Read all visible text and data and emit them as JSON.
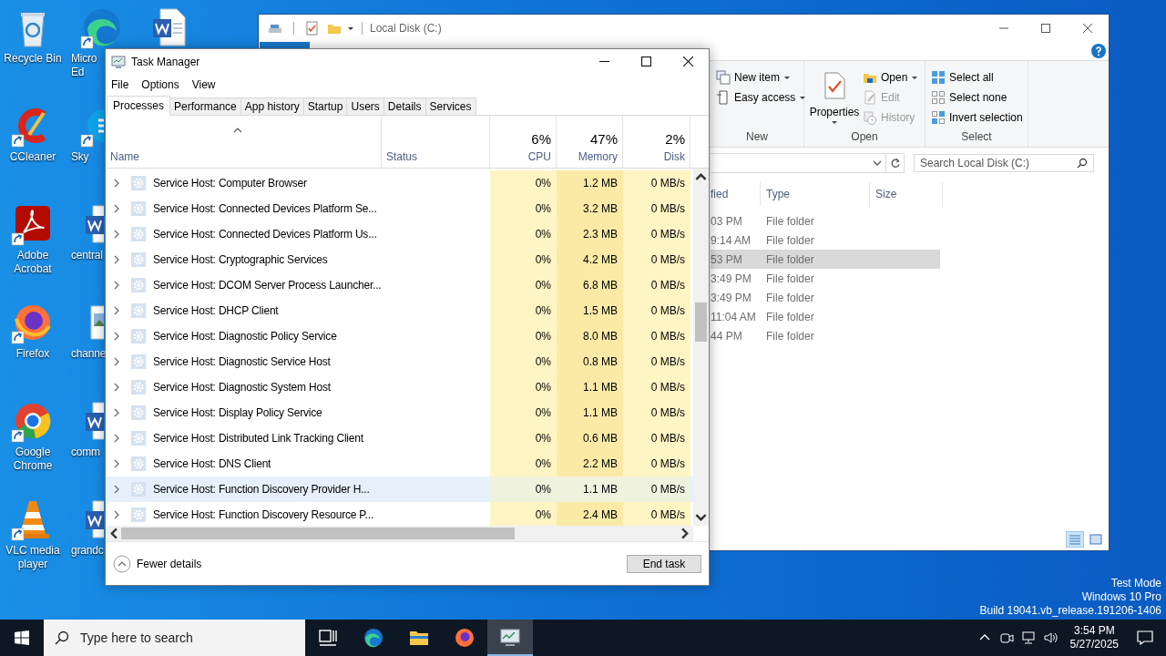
{
  "desktop": {
    "columns": [
      [
        {
          "kind": "recycle",
          "label": "Recycle Bin",
          "shortcut": false
        },
        {
          "kind": "ccleaner",
          "label": "CCleaner",
          "shortcut": true
        },
        {
          "kind": "acrobat",
          "label": "Adobe Acrobat",
          "shortcut": true
        },
        {
          "kind": "firefox",
          "label": "Firefox",
          "shortcut": true
        },
        {
          "kind": "chrome",
          "label": "Google Chrome",
          "shortcut": true
        },
        {
          "kind": "vlc",
          "label": "VLC media player",
          "shortcut": true
        }
      ],
      [
        {
          "kind": "edge",
          "label": "Micro Ed",
          "shortcut": true
        },
        {
          "kind": "skype",
          "label": "Sky",
          "shortcut": true
        },
        {
          "kind": "word",
          "label": "central",
          "shortcut": false
        },
        {
          "kind": "image",
          "label": "channe",
          "shortcut": false
        },
        {
          "kind": "word",
          "label": "comm",
          "shortcut": false
        },
        {
          "kind": "word",
          "label": "grandc",
          "shortcut": false
        }
      ],
      [
        {
          "kind": "word",
          "shortcut": false
        }
      ]
    ],
    "os_notice": [
      "Test Mode",
      "Windows 10 Pro",
      "Build 19041.vb_release.191206-1406"
    ]
  },
  "explorer": {
    "title": "Local Disk (C:)",
    "ribbon_groups": [
      {
        "label": "New",
        "items": [
          {
            "kind": "new-item",
            "label": "New item",
            "dropdown": true,
            "disabled": false
          },
          {
            "kind": "easy-access",
            "label": "Easy access",
            "dropdown": true,
            "disabled": false
          }
        ]
      },
      {
        "label": "Open",
        "items": [
          {
            "kind": "properties",
            "label": "Properties",
            "dropdown": true,
            "disabled": false
          },
          {
            "kind": "open",
            "label": "Open",
            "dropdown": true,
            "disabled": false
          },
          {
            "kind": "edit",
            "label": "Edit",
            "dropdown": false,
            "disabled": true
          },
          {
            "kind": "history",
            "label": "History",
            "dropdown": false,
            "disabled": true
          }
        ]
      },
      {
        "label": "Select",
        "items": [
          {
            "kind": "select-all",
            "label": "Select all",
            "dropdown": false,
            "disabled": false
          },
          {
            "kind": "select-none",
            "label": "Select none",
            "dropdown": false,
            "disabled": false
          },
          {
            "kind": "invert",
            "label": "Invert selection",
            "dropdown": false,
            "disabled": false
          }
        ]
      }
    ],
    "search": {
      "placeholder": "Search Local Disk (C:)"
    },
    "columns": [
      "fied",
      "Type",
      "Size"
    ],
    "rows": [
      {
        "modified": "03 PM",
        "type": "File folder",
        "selected": false
      },
      {
        "modified": "9:14 AM",
        "type": "File folder",
        "selected": false
      },
      {
        "modified": "53 PM",
        "type": "File folder",
        "selected": true
      },
      {
        "modified": "3:49 PM",
        "type": "File folder",
        "selected": false
      },
      {
        "modified": "3:49 PM",
        "type": "File folder",
        "selected": false
      },
      {
        "modified": "11:04 AM",
        "type": "File folder",
        "selected": false
      },
      {
        "modified": "44 PM",
        "type": "File folder",
        "selected": false
      }
    ]
  },
  "task_manager": {
    "title": "Task Manager",
    "menu": [
      "File",
      "Options",
      "View"
    ],
    "tabs": [
      {
        "label": "Processes",
        "selected": true
      },
      {
        "label": "Performance",
        "selected": false
      },
      {
        "label": "App history",
        "selected": false
      },
      {
        "label": "Startup",
        "selected": false
      },
      {
        "label": "Users",
        "selected": false
      },
      {
        "label": "Details",
        "selected": false
      },
      {
        "label": "Services",
        "selected": false
      }
    ],
    "columns": [
      {
        "label": "Name"
      },
      {
        "label": "Status"
      },
      {
        "label": "CPU",
        "usage": "6%"
      },
      {
        "label": "Memory",
        "usage": "47%"
      },
      {
        "label": "Disk",
        "usage": "2%"
      }
    ],
    "rows": [
      {
        "name": "Service Host: Computer Browser",
        "cpu": "0%",
        "memory": "1.2 MB",
        "disk": "0 MB/s",
        "selected": false
      },
      {
        "name": "Service Host: Connected Devices Platform Se...",
        "cpu": "0%",
        "memory": "3.2 MB",
        "disk": "0 MB/s",
        "selected": false
      },
      {
        "name": "Service Host: Connected Devices Platform Us...",
        "cpu": "0%",
        "memory": "2.3 MB",
        "disk": "0 MB/s",
        "selected": false
      },
      {
        "name": "Service Host: Cryptographic Services",
        "cpu": "0%",
        "memory": "4.2 MB",
        "disk": "0 MB/s",
        "selected": false
      },
      {
        "name": "Service Host: DCOM Server Process Launcher...",
        "cpu": "0%",
        "memory": "6.8 MB",
        "disk": "0 MB/s",
        "selected": false
      },
      {
        "name": "Service Host: DHCP Client",
        "cpu": "0%",
        "memory": "1.5 MB",
        "disk": "0 MB/s",
        "selected": false
      },
      {
        "name": "Service Host: Diagnostic Policy Service",
        "cpu": "0%",
        "memory": "8.0 MB",
        "disk": "0 MB/s",
        "selected": false
      },
      {
        "name": "Service Host: Diagnostic Service Host",
        "cpu": "0%",
        "memory": "0.8 MB",
        "disk": "0 MB/s",
        "selected": false
      },
      {
        "name": "Service Host: Diagnostic System Host",
        "cpu": "0%",
        "memory": "1.1 MB",
        "disk": "0 MB/s",
        "selected": false
      },
      {
        "name": "Service Host: Display Policy Service",
        "cpu": "0%",
        "memory": "1.1 MB",
        "disk": "0 MB/s",
        "selected": false
      },
      {
        "name": "Service Host: Distributed Link Tracking Client",
        "cpu": "0%",
        "memory": "0.6 MB",
        "disk": "0 MB/s",
        "selected": false
      },
      {
        "name": "Service Host: DNS Client",
        "cpu": "0%",
        "memory": "2.2 MB",
        "disk": "0 MB/s",
        "selected": false
      },
      {
        "name": "Service Host: Function Discovery Provider H...",
        "cpu": "0%",
        "memory": "1.1 MB",
        "disk": "0 MB/s",
        "selected": true
      },
      {
        "name": "Service Host: Function Discovery Resource P...",
        "cpu": "0%",
        "memory": "2.4 MB",
        "disk": "0 MB/s",
        "selected": false
      }
    ],
    "fewer_details": "Fewer details",
    "end_task": "End task"
  },
  "taskbar": {
    "search": {
      "placeholder": "Type here to search"
    },
    "apps": [
      {
        "kind": "task-view",
        "selected": false
      },
      {
        "kind": "edge",
        "selected": false
      },
      {
        "kind": "explorer",
        "selected": false
      },
      {
        "kind": "firefox",
        "selected": false
      },
      {
        "kind": "task-manager",
        "selected": true
      }
    ],
    "time": "3:54 PM",
    "date": "5/27/2025"
  }
}
